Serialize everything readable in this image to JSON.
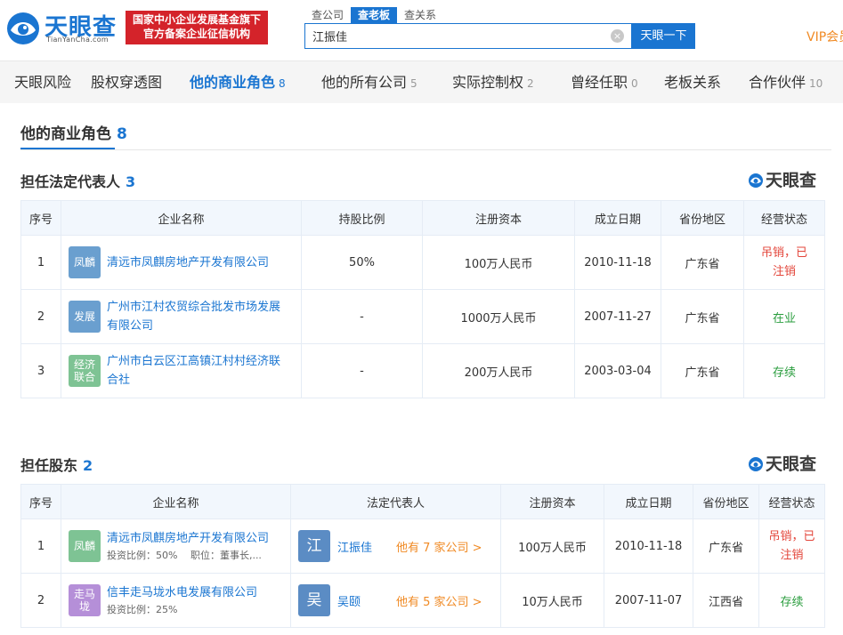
{
  "header": {
    "logo_name": "天眼查",
    "logo_sub": "TianYanCha.com",
    "badge_line1": "国家中小企业发展基金旗下",
    "badge_line2": "官方备案企业征信机构",
    "search_tabs": [
      "查公司",
      "查老板",
      "查关系"
    ],
    "search_value": "江振佳",
    "search_button": "天眼一下",
    "vip": "VIP会员"
  },
  "nav": [
    {
      "label": "天眼风险",
      "count": ""
    },
    {
      "label": "股权穿透图",
      "count": ""
    },
    {
      "label": "他的商业角色",
      "count": "8"
    },
    {
      "label": "他的所有公司",
      "count": "5"
    },
    {
      "label": "实际控制权",
      "count": "2"
    },
    {
      "label": "曾经任职",
      "count": "0"
    },
    {
      "label": "老板关系",
      "count": ""
    },
    {
      "label": "合作伙伴",
      "count": "10"
    }
  ],
  "page_title": {
    "label": "他的商业角色",
    "count": "8"
  },
  "brand": "天眼查",
  "legal_rep": {
    "title": "担任法定代表人",
    "count": "3",
    "headers": [
      "序号",
      "企业名称",
      "持股比例",
      "注册资本",
      "成立日期",
      "省份地区",
      "经营状态"
    ],
    "rows": [
      {
        "no": "1",
        "logo": "凤麟",
        "logo_color": "#6a9fcf",
        "name": "清远市凤麒房地产开发有限公司",
        "share": "50%",
        "capital": "100万人民币",
        "date": "2010-11-18",
        "region": "广东省",
        "status": "吊销，已注销",
        "status_color": "red"
      },
      {
        "no": "2",
        "logo": "发展",
        "logo_color": "#6a9fcf",
        "name": "广州市江村农贸综合批发市场发展有限公司",
        "share": "-",
        "capital": "1000万人民币",
        "date": "2007-11-27",
        "region": "广东省",
        "status": "在业",
        "status_color": "green"
      },
      {
        "no": "3",
        "logo": "经济联合",
        "logo_color": "#7ec394",
        "name": "广州市白云区江高镇江村村经济联合社",
        "share": "-",
        "capital": "200万人民币",
        "date": "2003-03-04",
        "region": "广东省",
        "status": "存续",
        "status_color": "green"
      }
    ]
  },
  "shareholder": {
    "title": "担任股东",
    "count": "2",
    "headers": [
      "序号",
      "企业名称",
      "法定代表人",
      "注册资本",
      "成立日期",
      "省份地区",
      "经营状态"
    ],
    "rows": [
      {
        "no": "1",
        "logo": "凤麟",
        "logo_color": "#7ec394",
        "name": "清远市凤麒房地产开发有限公司",
        "sub": "投资比例：50%　 职位：董事长,...",
        "rep_avatar": "江",
        "rep_name": "江振佳",
        "rep_more": "他有 7 家公司 >",
        "capital": "100万人民币",
        "date": "2010-11-18",
        "region": "广东省",
        "status": "吊销，已注销",
        "status_color": "red"
      },
      {
        "no": "2",
        "logo": "走马垅",
        "logo_color": "#b58fd8",
        "name": "信丰走马垅水电发展有限公司",
        "sub": "投资比例：25%",
        "rep_avatar": "吴",
        "rep_name": "吴颐",
        "rep_more": "他有 5 家公司 >",
        "capital": "10万人民币",
        "date": "2007-11-07",
        "region": "江西省",
        "status": "存续",
        "status_color": "green"
      }
    ]
  }
}
